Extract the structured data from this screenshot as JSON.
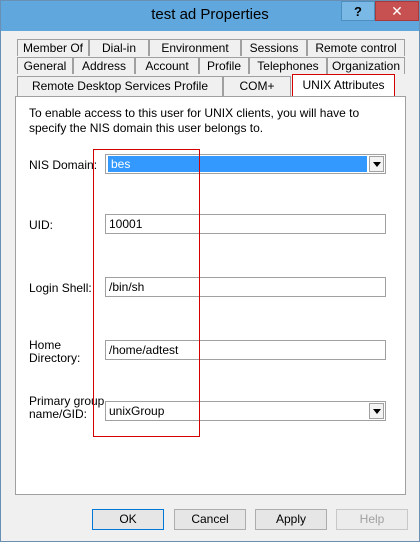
{
  "window": {
    "title": "test ad Properties"
  },
  "titlebar": {
    "help_label": "?",
    "close_label": "✕"
  },
  "tabs": {
    "row1": [
      "Member Of",
      "Dial-in",
      "Environment",
      "Sessions",
      "Remote control"
    ],
    "row2": [
      "General",
      "Address",
      "Account",
      "Profile",
      "Telephones",
      "Organization"
    ],
    "row3": [
      "Remote Desktop Services Profile",
      "COM+",
      "UNIX Attributes"
    ],
    "active": "UNIX Attributes"
  },
  "panel": {
    "intro": "To enable access to this user for UNIX clients, you will have to specify the NIS domain this user belongs to.",
    "nis_domain": {
      "label": "NIS Domain:",
      "value": "bes"
    },
    "uid": {
      "label": "UID:",
      "value": "10001"
    },
    "login_shell": {
      "label": "Login Shell:",
      "value": "/bin/sh"
    },
    "home_directory": {
      "label_line1": "Home",
      "label_line2": "Directory:",
      "value": "/home/adtest"
    },
    "primary_group": {
      "label_line1": "Primary group",
      "label_line2": "name/GID:",
      "value": "unixGroup"
    }
  },
  "buttons": {
    "ok": "OK",
    "cancel": "Cancel",
    "apply": "Apply",
    "help": "Help"
  },
  "colors": {
    "titlebar": "#5fa7dc",
    "highlight": "#d40000",
    "selection": "#3399ff"
  }
}
